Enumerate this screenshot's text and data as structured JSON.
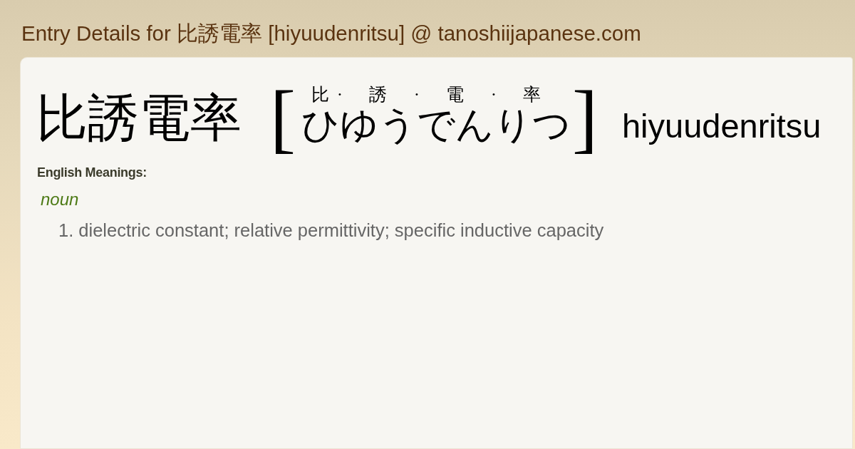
{
  "page_title": "Entry Details for 比誘電率 [hiyuudenritsu] @ tanoshiijapanese.com",
  "entry": {
    "word": "比誘電率",
    "open_bracket": "[",
    "reading": [
      {
        "kanji": "比",
        "kana": "ひ",
        "separator": "·"
      },
      {
        "kanji": "誘",
        "kana": "ゆう",
        "separator": "·"
      },
      {
        "kanji": "電",
        "kana": "でん",
        "separator": "·"
      },
      {
        "kanji": "率",
        "kana": "りつ"
      }
    ],
    "close_bracket": "]",
    "romaji": "hiyuudenritsu"
  },
  "meanings": {
    "heading": "English Meanings:",
    "groups": [
      {
        "part_of_speech": "noun",
        "senses": [
          {
            "number": "1.",
            "text": "dielectric constant; relative permittivity; specific inductive capacity"
          }
        ]
      }
    ]
  }
}
